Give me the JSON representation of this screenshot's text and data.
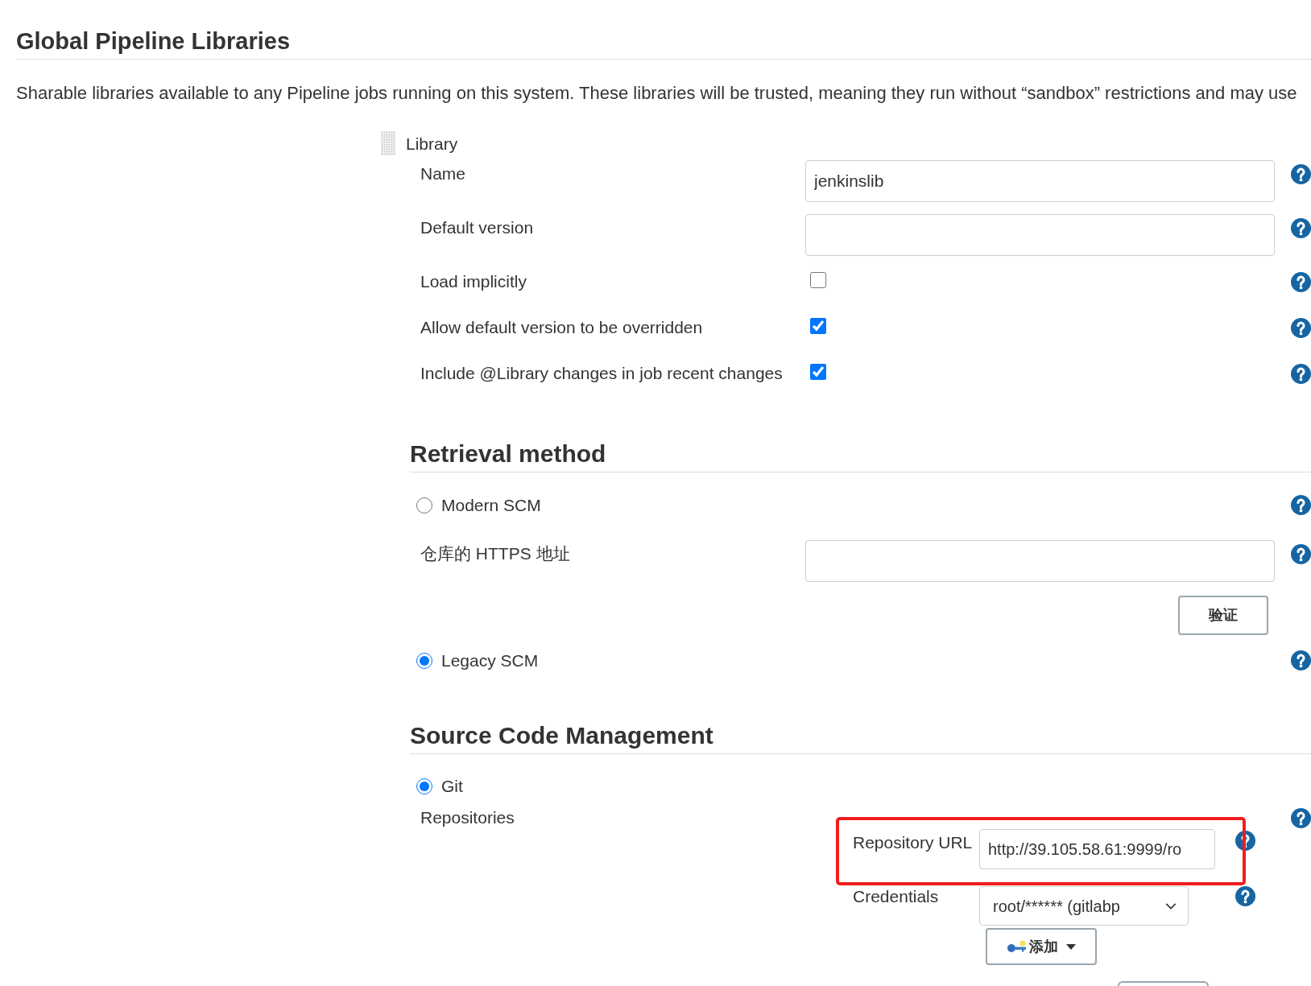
{
  "section": {
    "title": "Global Pipeline Libraries",
    "description": "Sharable libraries available to any Pipeline jobs running on this system. These libraries will be trusted, meaning they run without “sandbox” restrictions and may use"
  },
  "library": {
    "header": "Library",
    "fields": [
      {
        "kind": "text",
        "label": "Name",
        "value": "jenkinslib",
        "help": true
      },
      {
        "kind": "text",
        "label": "Default version",
        "help": true
      },
      {
        "kind": "checkbox",
        "label": "Load implicitly",
        "checked": false,
        "help": true
      },
      {
        "kind": "checkbox",
        "label": "Allow default version to be overridden",
        "checked": true,
        "help": true
      },
      {
        "kind": "checkbox",
        "label": "Include @Library changes in job recent changes",
        "checked": true,
        "help": true
      }
    ]
  },
  "retrieval_method": {
    "title": "Retrieval method",
    "items": [
      {
        "kind": "radio",
        "label": "Modern SCM",
        "selected": false,
        "help": true
      },
      {
        "kind": "text",
        "label": "仓库的 HTTPS 地址",
        "help": true
      },
      {
        "kind": "button",
        "label": "验证"
      },
      {
        "kind": "radio",
        "label": "Legacy SCM",
        "selected": true,
        "help": true
      }
    ]
  },
  "source_code_management": {
    "title": "Source Code Management",
    "items": [
      {
        "kind": "radio",
        "label": "Git",
        "selected": true
      }
    ],
    "repositories": {
      "label": "Repositories",
      "help": true,
      "url": {
        "label": "Repository URL",
        "value": "http://39.105.58.61:9999/ro",
        "highlighted": true,
        "help": true
      },
      "credentials": {
        "label": "Credentials",
        "value": "root/****** (gitlabp",
        "help": true
      },
      "buttons": [
        {
          "kind": "add",
          "label": "添加"
        },
        {
          "kind": "cut_off"
        }
      ]
    }
  }
}
